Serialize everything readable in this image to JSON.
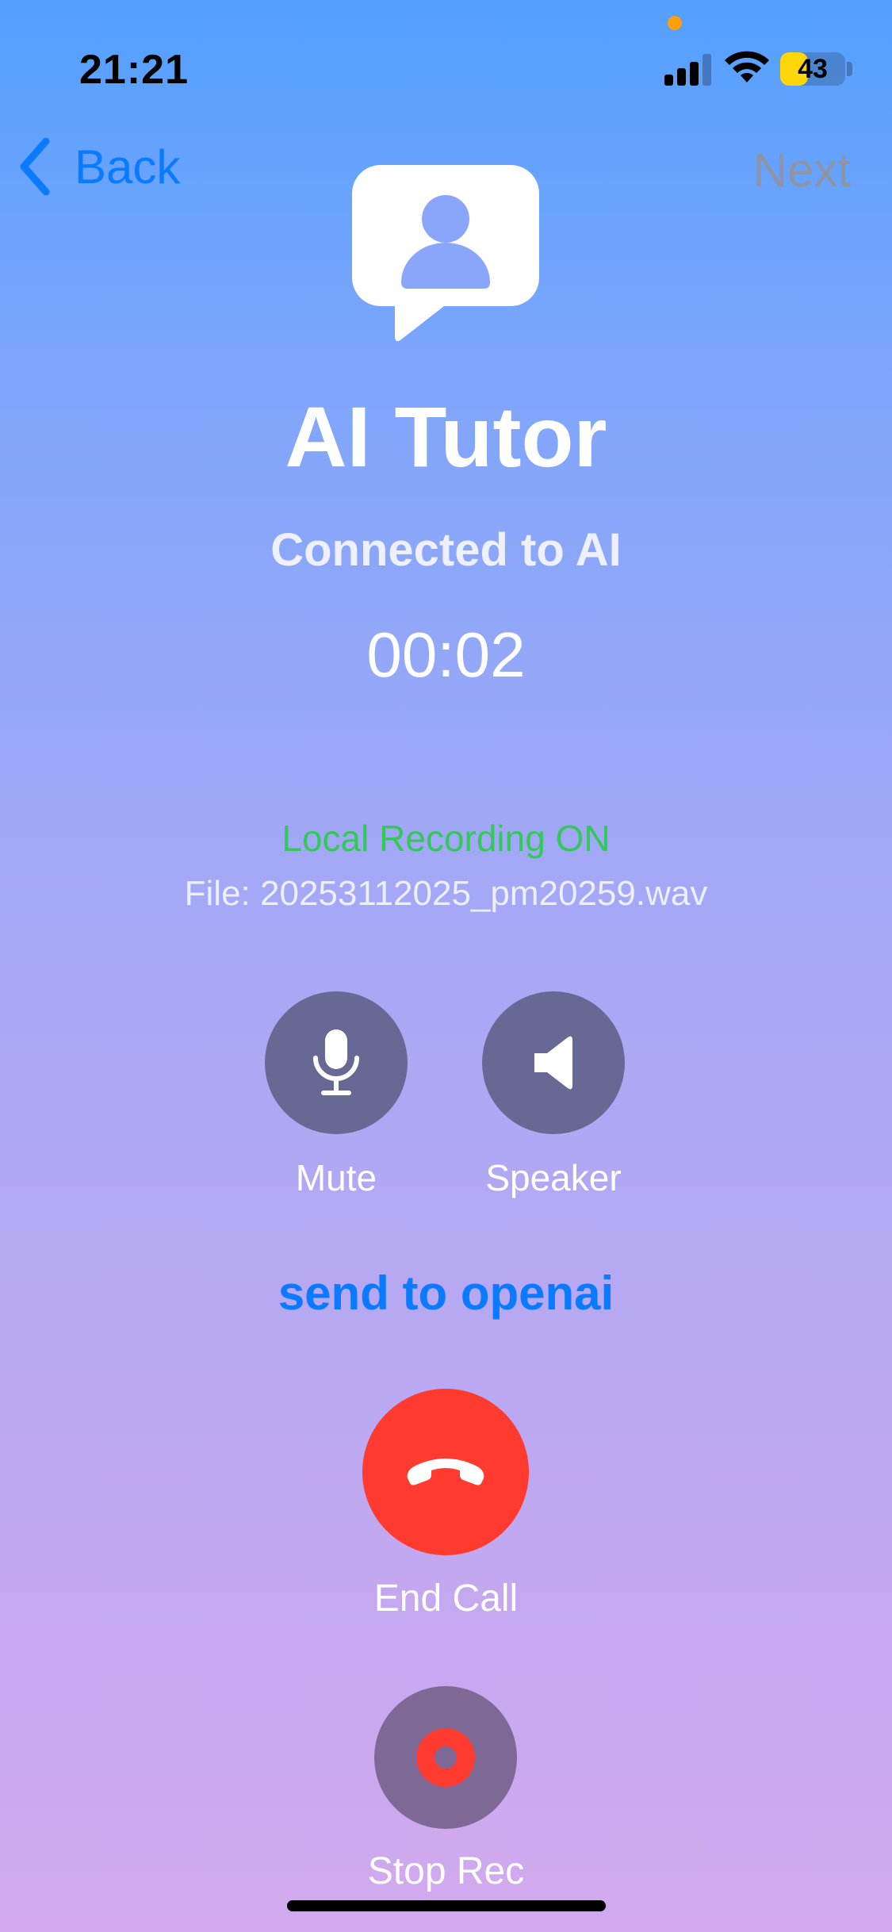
{
  "status_bar": {
    "time": "21:21",
    "battery": "43",
    "battery_level": 0.43,
    "icons": [
      "cellular-signal-icon",
      "wifi-icon",
      "battery-icon",
      "privacy-indicator-dot"
    ]
  },
  "nav": {
    "back_label": "Back",
    "next_label": "Next"
  },
  "header": {
    "icon": "person-speech-bubble-icon",
    "title": "AI Tutor",
    "subtitle": "Connected to AI",
    "timer": "00:02"
  },
  "recording": {
    "status": "Local Recording ON",
    "file": "File: 20253112025_pm20259.wav"
  },
  "controls": {
    "mute_label": "Mute",
    "speaker_label": "Speaker",
    "send_link": "send to openai",
    "end_call_label": "End Call",
    "stop_rec_label": "Stop Rec"
  },
  "colors": {
    "accent": "#0a7aff",
    "recording_on": "#34c759",
    "end_call": "#ff3b30",
    "control_bg": "#686894",
    "gradient_top": "#53a0fe",
    "gradient_bottom": "#d2a9ee"
  }
}
